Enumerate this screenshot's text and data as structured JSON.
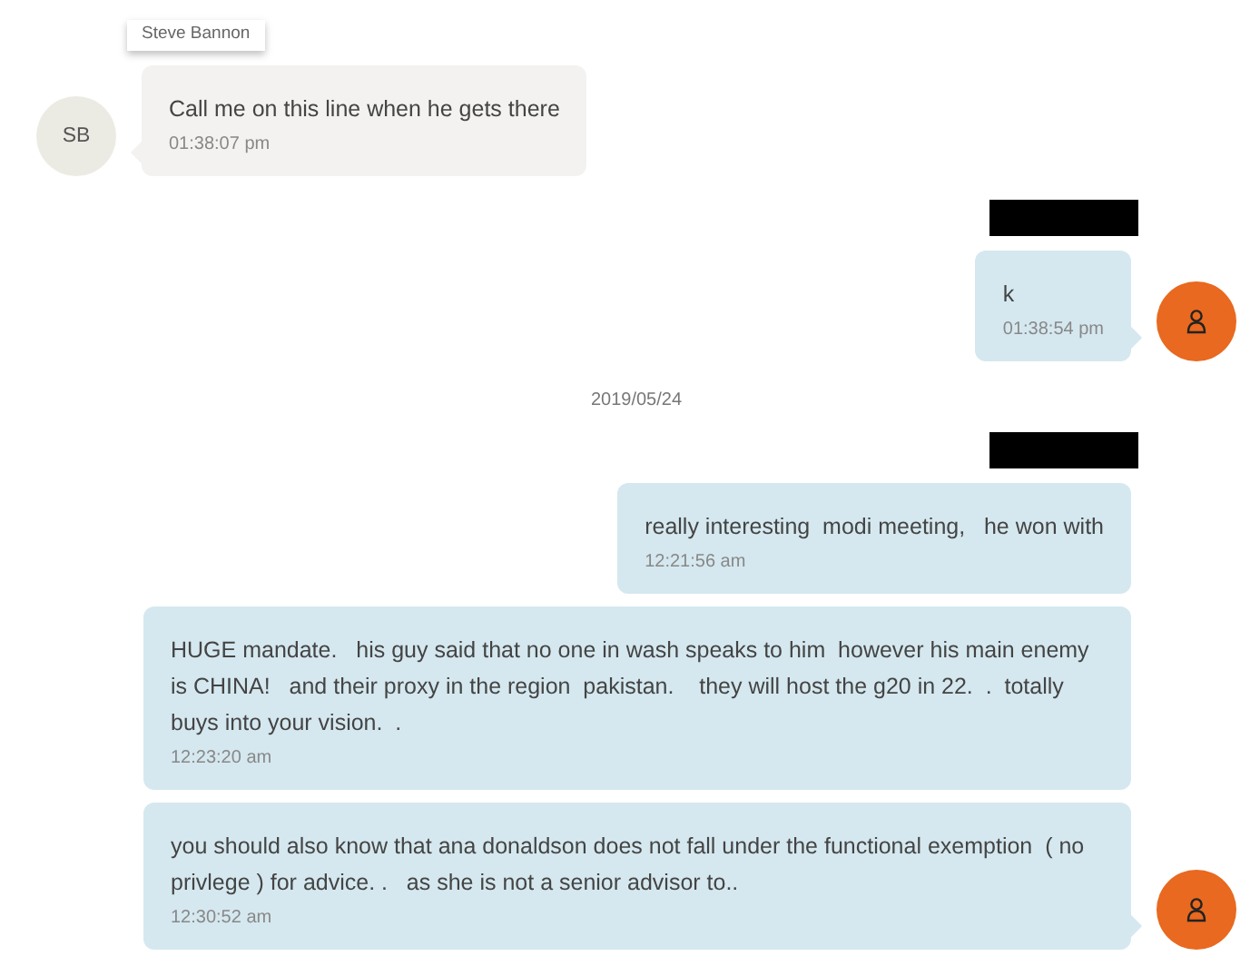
{
  "messages": [
    {
      "kind": "incoming",
      "sender": "Steve Bannon",
      "redacted_name": false,
      "show_avatar": true,
      "initials": "SB",
      "text": "Call me on this line when he gets there",
      "time": "01:38:07 pm"
    },
    {
      "kind": "outgoing",
      "redacted_name": true,
      "show_avatar": true,
      "text": "k",
      "time": "01:38:54 pm"
    },
    {
      "kind": "date",
      "text": "2019/05/24"
    },
    {
      "kind": "outgoing",
      "redacted_name": true,
      "show_avatar": false,
      "text": "really interesting  modi meeting,   he won with",
      "time": "12:21:56 am"
    },
    {
      "kind": "outgoing",
      "redacted_name": false,
      "show_avatar": false,
      "text": "HUGE mandate.   his guy said that no one in wash speaks to him  however his main enemy is CHINA!   and their proxy in the region  pakistan.    they will host the g20 in 22.  .  totally buys into your vision.  .",
      "time": "12:23:20 am"
    },
    {
      "kind": "outgoing",
      "redacted_name": false,
      "show_avatar": true,
      "text": "you should also know that ana donaldson does not fall under the functional exemption  ( no privlege ) for advice. .   as she is not a senior advisor to..",
      "time": "12:30:52 am"
    }
  ]
}
